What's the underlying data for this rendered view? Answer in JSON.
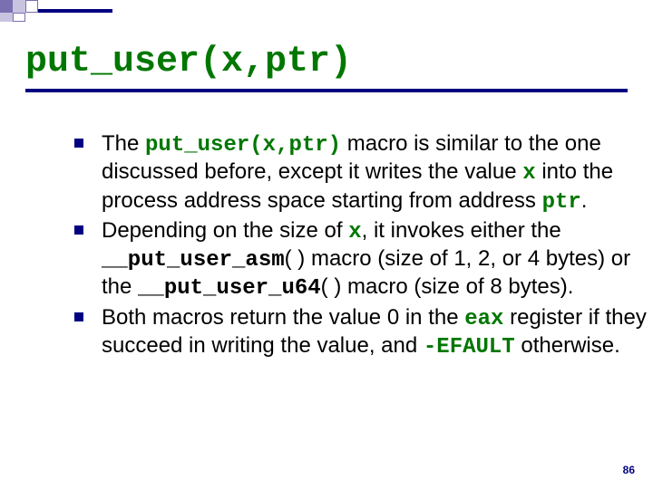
{
  "title": "put_user(x,ptr)",
  "bullets": [
    {
      "segments": [
        {
          "t": "The ",
          "cls": ""
        },
        {
          "t": "put_user(x,ptr)",
          "cls": "code"
        },
        {
          "t": " macro is similar to the one discussed before, except it writes the value ",
          "cls": ""
        },
        {
          "t": "x",
          "cls": "code"
        },
        {
          "t": " into the process address space starting from address ",
          "cls": ""
        },
        {
          "t": "ptr",
          "cls": "code"
        },
        {
          "t": ".",
          "cls": ""
        }
      ]
    },
    {
      "segments": [
        {
          "t": "Depending on the size of ",
          "cls": ""
        },
        {
          "t": "x",
          "cls": "code"
        },
        {
          "t": ", it invokes either the ",
          "cls": ""
        },
        {
          "t": "__put_user_asm",
          "cls": "codeblack"
        },
        {
          "t": "( ) macro (size of 1, 2, or 4 bytes) or the ",
          "cls": ""
        },
        {
          "t": "__put_user_u64",
          "cls": "codeblack"
        },
        {
          "t": "( ) macro (size of 8 bytes).",
          "cls": ""
        }
      ]
    },
    {
      "segments": [
        {
          "t": "Both macros return the value 0 in the ",
          "cls": ""
        },
        {
          "t": "eax",
          "cls": "code"
        },
        {
          "t": " register if they succeed in writing the value, and ",
          "cls": ""
        },
        {
          "t": "-EFAULT",
          "cls": "code"
        },
        {
          "t": " otherwise.",
          "cls": ""
        }
      ]
    }
  ],
  "pagenum": "86"
}
